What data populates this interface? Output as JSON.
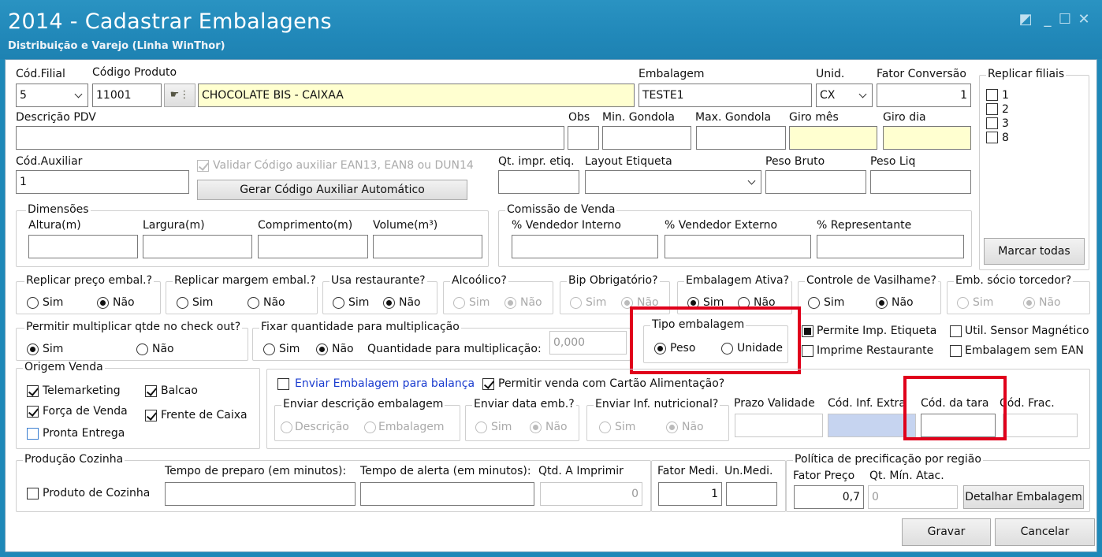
{
  "window": {
    "title": "2014 - Cadastrar Embalagens",
    "subtitle": "Distribuição e Varejo (Linha WinThor)"
  },
  "top": {
    "cod_filial_label": "Cód.Filial",
    "cod_filial_value": "5",
    "codigo_produto_label": "Código Produto",
    "codigo_produto_value": "11001",
    "produto_nome": "CHOCOLATE BIS  - CAIXAA",
    "embalagem_label": "Embalagem",
    "embalagem_value": "TESTE1",
    "unid_label": "Unid.",
    "unid_value": "CX",
    "fator_label": "Fator Conversão",
    "fator_value": "1"
  },
  "replicar_filiais": {
    "title": "Replicar filiais",
    "items": [
      "1",
      "2",
      "3",
      "8"
    ],
    "button": "Marcar todas"
  },
  "row2": {
    "descricao_pdv": "Descrição PDV",
    "obs": "Obs",
    "min_gondola": "Min. Gondola",
    "max_gondola": "Max. Gondola",
    "giro_mes": "Giro mês",
    "giro_dia": "Giro dia"
  },
  "row3": {
    "cod_auxiliar_label": "Cód.Auxiliar",
    "cod_auxiliar_value": "1",
    "validar_label": "Validar Código auxiliar EAN13, EAN8 ou DUN14",
    "gerar_btn": "Gerar Código Auxiliar Automático",
    "qt_impr": "Qt. impr. etiq.",
    "layout_etiqueta": "Layout Etiqueta",
    "peso_bruto": "Peso Bruto",
    "peso_liq": "Peso Liq"
  },
  "dimensoes": {
    "title": "Dimensões",
    "altura": "Altura(m)",
    "largura": "Largura(m)",
    "comprimento": "Comprimento(m)",
    "volume": "Volume(m³)"
  },
  "comissao": {
    "title": "Comissão de Venda",
    "vend_int": "% Vendedor Interno",
    "vend_ext": "% Vendedor Externo",
    "repr": "% Representante"
  },
  "common": {
    "sim": "Sim",
    "nao": "Não"
  },
  "opts": {
    "replicar_preco": "Replicar preço embal.?",
    "replicar_margem": "Replicar margem embal.?",
    "usa_restaurante": "Usa restaurante?",
    "alcoolico": "Alcoólico?",
    "bip": "Bip Obrigatório?",
    "emb_ativa": "Embalagem Ativa?",
    "vasilhame": "Controle de Vasilhame?",
    "socio": "Emb. sócio torcedor?"
  },
  "row_mult": {
    "permitir": "Permitir multiplicar qtde no check out?",
    "fixar": "Fixar quantidade para multiplicação",
    "qtd_label": "Quantidade para multiplicação:",
    "qtd_value": "0,000"
  },
  "tipo_emb": {
    "title": "Tipo embalagem",
    "peso": "Peso",
    "unidade": "Unidade"
  },
  "checks_right": {
    "permite_imp": "Permite Imp. Etiqueta",
    "util_sensor": "Util. Sensor Magnético",
    "imprime_rest": "Imprime Restaurante",
    "sem_ean": "Embalagem sem EAN"
  },
  "origem": {
    "title": "Origem Venda",
    "telemarketing": "Telemarketing",
    "balcao": "Balcao",
    "forca": "Força de Venda",
    "frente": "Frente de Caixa",
    "pronta": "Pronta Entrega"
  },
  "balanca": {
    "enviar": "Enviar Embalagem para balança",
    "cartao": "Permitir venda com Cartão Alimentação?",
    "env_desc": "Enviar descrição embalagem",
    "descricao": "Descrição",
    "embalagem": "Embalagem",
    "env_data": "Enviar data emb.?",
    "env_nutri": "Enviar Inf. nutricional?",
    "prazo": "Prazo Validade",
    "cod_inf": "Cód. Inf. Extra",
    "cod_tara": "Cód. da tara",
    "cod_frac": "Cód. Frac."
  },
  "cozinha": {
    "title": "Produção Cozinha",
    "produto": "Produto de Cozinha",
    "tempo_prep": "Tempo de preparo (em minutos):",
    "tempo_alerta": "Tempo de alerta (em minutos):",
    "qtd_imprimir": "Qtd. A Imprimir",
    "qtd_value": "0"
  },
  "fator": {
    "fator_medi": "Fator Medi.",
    "un_medi": "Un.Medi.",
    "fator_value": "1"
  },
  "politica": {
    "title": "Política de precificação por região",
    "fator_preco": "Fator Preço",
    "fator_preco_value": "0,7",
    "qt_min": "Qt. Mín. Atac.",
    "qt_min_value": "0",
    "detalhar": "Detalhar Embalagem"
  },
  "footer": {
    "gravar": "Gravar",
    "cancelar": "Cancelar"
  }
}
